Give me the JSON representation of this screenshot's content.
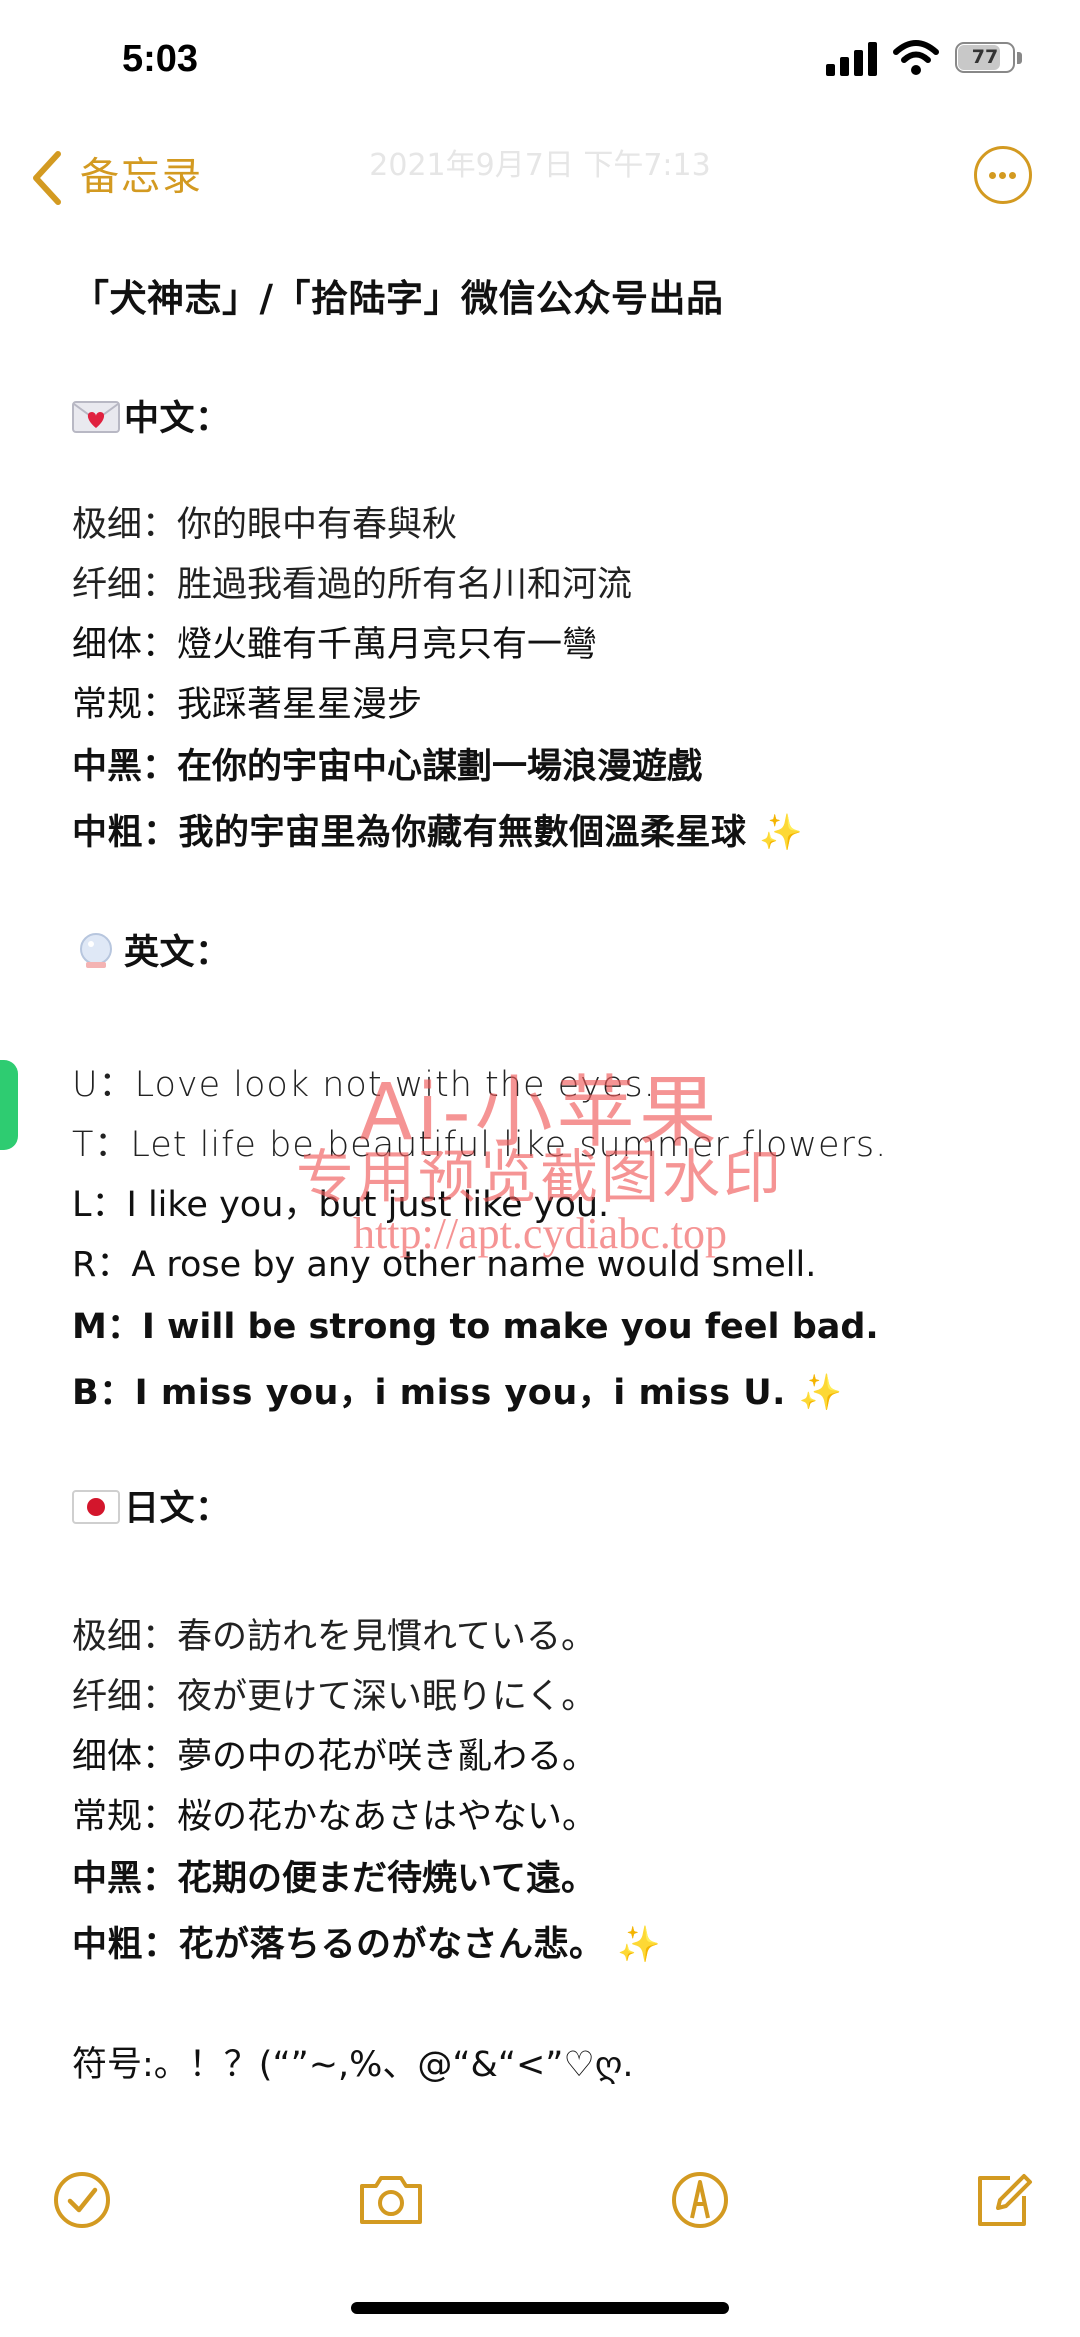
{
  "status_bar": {
    "time": "5:03",
    "battery_level": "77",
    "battery_pct": 0.77
  },
  "nav": {
    "back_label": "备忘录",
    "date": "2021年9月7日 下午7:13"
  },
  "note": {
    "title": "「犬神志」/「拾陆字」微信公众号出品",
    "sections": [
      {
        "heading": "中文：",
        "icon": "love-letter-icon",
        "lines": [
          "极细：你的眼中有春與秋",
          "纤细：胜過我看過的所有名川和河流",
          "细体：燈火雖有千萬月亮只有一彎",
          "常规：我踩著星星漫步",
          "中黑：在你的宇宙中心謀劃一場浪漫遊戲",
          "中粗：我的宇宙里為你藏有無數個溫柔星球"
        ]
      },
      {
        "heading": "英文：",
        "icon": "snow-globe-icon",
        "lines": [
          "U：Love look not with the eyes.",
          "T：Let life be beautiful like summer flowers.",
          "L：I like you，but just like you.",
          "R：A rose by any other name would smell.",
          "M：I will be strong to make you feel bad.",
          "B：I miss you，i miss you，i miss U."
        ]
      },
      {
        "heading": "日文：",
        "icon": "japan-flag-icon",
        "lines": [
          "极细：春の訪れを見慣れている。",
          "纤细：夜が更けて深い眠りにく。",
          "细体：夢の中の花が咲き亂わる。",
          "常规：桜の花かなあさはやない。",
          "中黑：花期の便まだ待焼いて遠。",
          "中粗：花が落ちるのがなさん悲。"
        ]
      }
    ],
    "symbols": "符号:。！？(“”~,%、@“&“<”♡ღ.",
    "sparkle": "✨"
  },
  "watermark": {
    "line1": "Ai-小苹果",
    "line2": "专用预览截图水印",
    "line3": "http://apt.cydiabc.top"
  },
  "colors": {
    "accent": "#d39a21",
    "watermark": "#f05a5a"
  }
}
